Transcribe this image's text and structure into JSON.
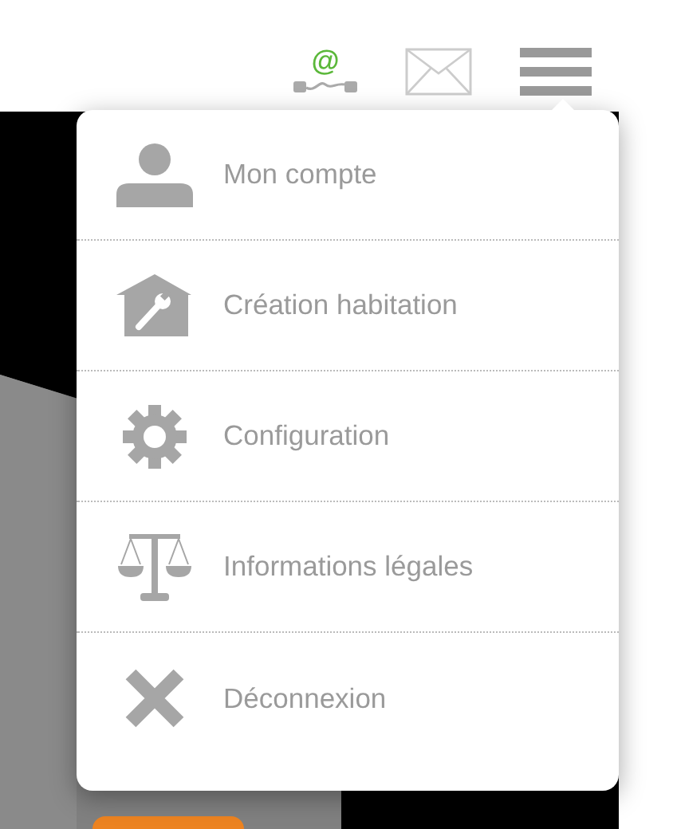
{
  "header": {
    "connection_icon_label": "@"
  },
  "menu": {
    "items": [
      {
        "label": "Mon compte"
      },
      {
        "label": "Création habitation"
      },
      {
        "label": "Configuration"
      },
      {
        "label": "Informations légales"
      },
      {
        "label": "Déconnexion"
      }
    ]
  }
}
